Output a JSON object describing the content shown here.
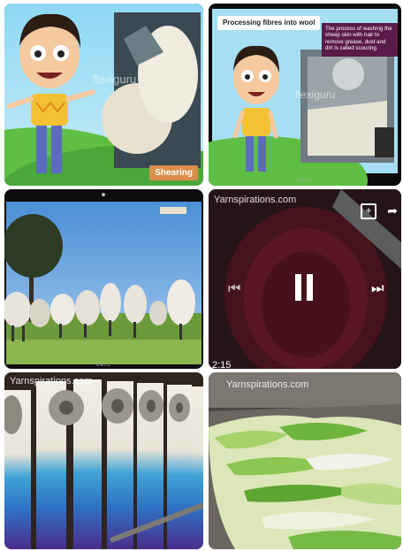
{
  "tiles": [
    {
      "watermark": "flexiguru",
      "badge": "Shearing"
    },
    {
      "watermark": "flexiguru",
      "title": "Processing fibres into wool",
      "note": "The process of washing the sheep skin with hair to remove grease, dust and dirt is called scouring.",
      "brand": "DELL"
    },
    {
      "brand": "DELL"
    },
    {
      "watermark": "Yarnspirations.com",
      "time": "2:15"
    },
    {
      "watermark": "Yarnspirations.com"
    },
    {
      "watermark": "Yarnspirations.com"
    }
  ]
}
